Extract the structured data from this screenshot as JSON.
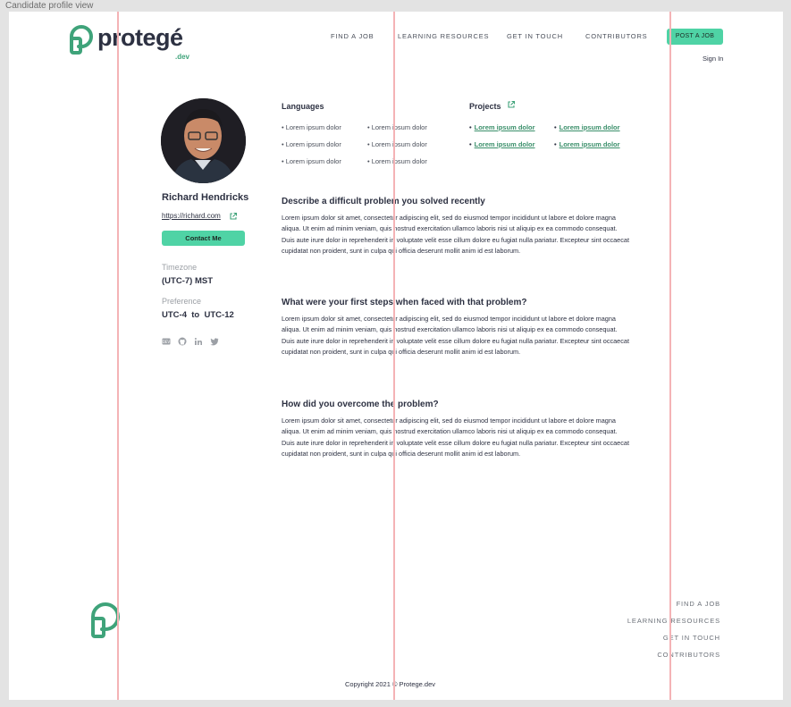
{
  "window": {
    "title": "Candidate profile view"
  },
  "brand": {
    "name": "protegé",
    "suffix": ".dev"
  },
  "nav": {
    "items": [
      "FIND A JOB",
      "LEARNING RESOURCES",
      "GET IN TOUCH",
      "CONTRIBUTORS"
    ],
    "post_job": "POST A JOB",
    "sign_in": "Sign In"
  },
  "profile": {
    "name": "Richard Hendricks",
    "website": "https://richard.com",
    "contact_label": "Contact Me",
    "timezone_label": "Timezone",
    "timezone_value": "(UTC-7) MST",
    "preference_label": "Preference",
    "preference_from": "UTC-4",
    "preference_to_word": "to",
    "preference_to": "UTC-12",
    "socials": [
      "dev-icon",
      "github-icon",
      "linkedin-icon",
      "twitter-icon"
    ]
  },
  "languages": {
    "title": "Languages",
    "items": [
      "Lorem ipsum dolor",
      "Lorem ipsum dolor",
      "Lorem ipsum dolor",
      "Lorem ipsum dolor",
      "Lorem ipsum dolor",
      "Lorem ipsum dolor"
    ]
  },
  "projects": {
    "title": "Projects",
    "items": [
      "Lorem ipsum dolor",
      "Lorem ipsum dolor",
      "Lorem ipsum dolor",
      "Lorem ipsum dolor"
    ]
  },
  "questions": [
    {
      "title": "Describe a difficult problem you solved recently",
      "body": "Lorem ipsum dolor sit amet, consectetur adipiscing elit, sed do eiusmod tempor incididunt ut labore et dolore magna aliqua. Ut enim ad minim veniam, quis nostrud exercitation ullamco laboris nisi ut aliquip ex ea commodo consequat. Duis aute irure dolor in reprehenderit in voluptate velit esse cillum dolore eu fugiat nulla pariatur. Excepteur sint occaecat cupidatat non proident, sunt in culpa qui officia deserunt mollit anim id est laborum."
    },
    {
      "title": "What were your first steps when faced with that problem?",
      "body": "Lorem ipsum dolor sit amet, consectetur adipiscing elit, sed do eiusmod tempor incididunt ut labore et dolore magna aliqua. Ut enim ad minim veniam, quis nostrud exercitation ullamco laboris nisi ut aliquip ex ea commodo consequat. Duis aute irure dolor in reprehenderit in voluptate velit esse cillum dolore eu fugiat nulla pariatur. Excepteur sint occaecat cupidatat non proident, sunt in culpa qui officia deserunt mollit anim id est laborum."
    },
    {
      "title": "How did you overcome the problem?",
      "body": "Lorem ipsum dolor sit amet, consectetur adipiscing elit, sed do eiusmod tempor incididunt ut labore et dolore magna aliqua. Ut enim ad minim veniam, quis nostrud exercitation ullamco laboris nisi ut aliquip ex ea commodo consequat. Duis aute irure dolor in reprehenderit in voluptate velit esse cillum dolore eu fugiat nulla pariatur. Excepteur sint occaecat cupidatat non proident, sunt in culpa qui officia deserunt mollit anim id est laborum."
    }
  ],
  "footer": {
    "links": [
      "FIND A JOB",
      "LEARNING RESOURCES",
      "GET IN TOUCH",
      "CONTRIBUTORS"
    ],
    "copyright": "Copyright 2021 © Protege.dev"
  },
  "colors": {
    "accent": "#4fd3a5",
    "brand_green": "#3fa37a",
    "text": "#2d3142",
    "guide": "#f4b3b6"
  }
}
